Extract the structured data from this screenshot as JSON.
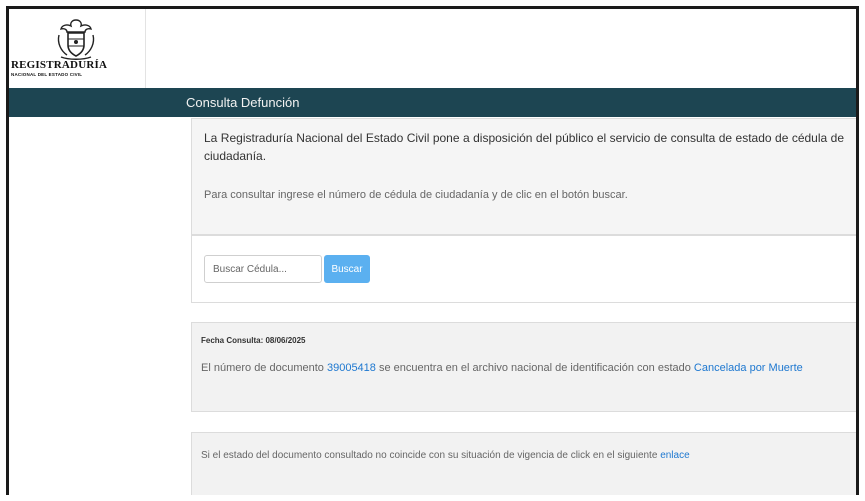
{
  "header": {
    "logo_name": "REGISTRADURÍA",
    "logo_subtitle": "NACIONAL DEL ESTADO CIVIL",
    "emblem": "coat-of-arms-icon"
  },
  "navbar": {
    "title": "Consulta Defunción"
  },
  "intro": {
    "text": "La Registraduría Nacional del Estado Civil pone a disposición del público el servicio de consulta de estado de cédula de ciudadanía.",
    "instruction": "Para consultar ingrese el número de cédula de ciudadanía y de clic en el botón buscar."
  },
  "search": {
    "placeholder": "Buscar Cédula...",
    "value": "",
    "button_label": "Buscar"
  },
  "result": {
    "date_label": "Fecha Consulta:",
    "date_value": "08/06/2025",
    "text_before": "El número de documento ",
    "document_number": "39005418",
    "text_middle": " se encuentra en el archivo nacional de identificación con estado ",
    "status": "Cancelada por Muerte"
  },
  "note": {
    "text": "Si el estado del documento consultado no coincide con su situación de vigencia de click en el siguiente ",
    "link_label": "enlace"
  },
  "colors": {
    "navbar_bg": "#1d4552",
    "button_bg": "#5bb0f0",
    "link": "#1e78d0",
    "panel_bg": "#f5f5f5"
  }
}
